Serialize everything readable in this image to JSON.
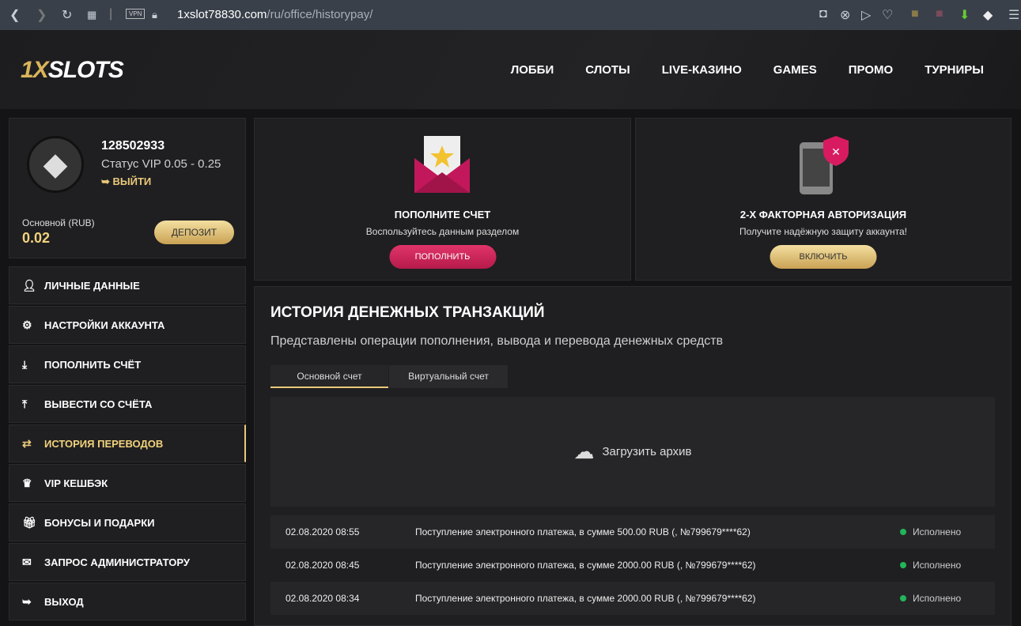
{
  "browser": {
    "url_host": "1xslot78830.com",
    "url_path": "/ru/office/historypay/",
    "vpn": "VPN"
  },
  "header": {
    "logo_gold": "1X",
    "logo_white": "SLOTS",
    "nav": [
      "ЛОББИ",
      "СЛОТЫ",
      "LIVE-КАЗИНО",
      "GAMES",
      "ПРОМО",
      "ТУРНИРЫ"
    ]
  },
  "profile": {
    "id": "128502933",
    "status": "Статус VIP 0.05 - 0.25",
    "logout": "ВЫЙТИ",
    "balance_label": "Основной (RUB)",
    "balance": "0.02",
    "deposit": "ДЕПОЗИТ"
  },
  "menu": [
    {
      "label": "ЛИЧНЫЕ ДАННЫЕ",
      "icon": "user-plus-icon"
    },
    {
      "label": "НАСТРОЙКИ АККАУНТА",
      "icon": "gears-icon"
    },
    {
      "label": "ПОПОЛНИТЬ СЧЁТ",
      "icon": "download-icon"
    },
    {
      "label": "ВЫВЕСТИ СО СЧЁТА",
      "icon": "upload-icon"
    },
    {
      "label": "ИСТОРИЯ ПЕРЕВОДОВ",
      "icon": "transfer-icon"
    },
    {
      "label": "VIP КЕШБЭК",
      "icon": "crown-icon"
    },
    {
      "label": "БОНУСЫ И ПОДАРКИ",
      "icon": "gift-icon"
    },
    {
      "label": "ЗАПРОС АДМИНИСТРАТОРУ",
      "icon": "envelope-icon"
    },
    {
      "label": "ВЫХОД",
      "icon": "exit-icon"
    }
  ],
  "cards": [
    {
      "title": "ПОПОЛНИТЕ СЧЕТ",
      "subtitle": "Воспользуйтесь данным разделом",
      "button": "ПОПОЛНИТЬ"
    },
    {
      "title": "2-Х ФАКТОРНАЯ АВТОРИЗАЦИЯ",
      "subtitle": "Получите надёжную защиту аккаунта!",
      "button": "ВКЛЮЧИТЬ"
    }
  ],
  "history": {
    "title": "ИСТОРИЯ ДЕНЕЖНЫХ ТРАНЗАКЦИЙ",
    "subtitle": "Представлены операции пополнения, вывода и перевода денежных средств",
    "tabs": [
      "Основной счет",
      "Виртуальный счет"
    ],
    "archive": "Загрузить архив",
    "rows": [
      {
        "date": "02.08.2020 08:55",
        "desc": "Поступление электронного платежа, в сумме 500.00 RUB (, №799679****62)",
        "status": "Исполнено"
      },
      {
        "date": "02.08.2020 08:45",
        "desc": "Поступление электронного платежа, в сумме 2000.00 RUB (, №799679****62)",
        "status": "Исполнено"
      },
      {
        "date": "02.08.2020 08:34",
        "desc": "Поступление электронного платежа, в сумме 2000.00 RUB (, №799679****62)",
        "status": "Исполнено"
      }
    ]
  }
}
